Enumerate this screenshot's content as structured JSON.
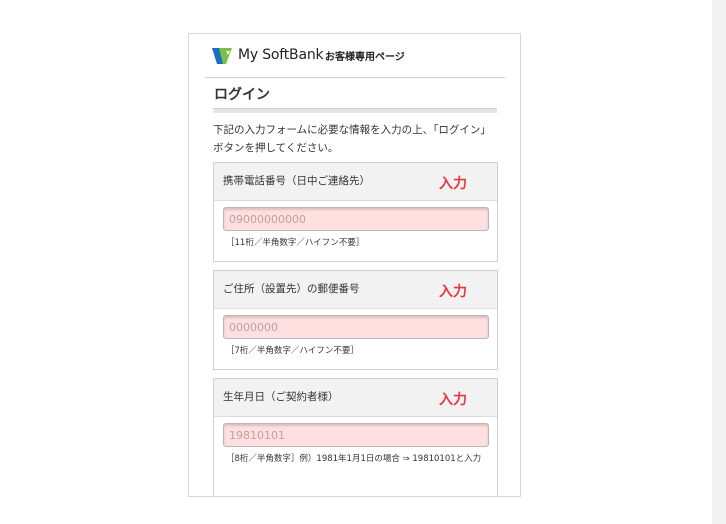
{
  "header": {
    "brand": "My SoftBank",
    "subtitle": "お客様専用ページ"
  },
  "page": {
    "title": "ログイン",
    "intro": "下記の入力フォームに必要な情報を入力の上、「ログイン」ボタンを押してください。"
  },
  "annotation_label": "入力",
  "fields": [
    {
      "label": "携帯電話番号（日中ご連絡先）",
      "placeholder": "09000000000",
      "hint": "［11桁／半角数字／ハイフン不要］"
    },
    {
      "label": "ご住所（設置先）の郵便番号",
      "placeholder": "0000000",
      "hint": "［7桁／半角数字／ハイフン不要］"
    },
    {
      "label": "生年月日（ご契約者様）",
      "placeholder": "19810101",
      "hint": "［8桁／半角数字］例）1981年1月1日の場合 ⇒ 19810101と入力"
    }
  ],
  "colors": {
    "annotation": "#e8373c",
    "field_background": "#ffe0e0",
    "logo_blue": "#1a6fc4",
    "logo_green": "#7ac143"
  }
}
